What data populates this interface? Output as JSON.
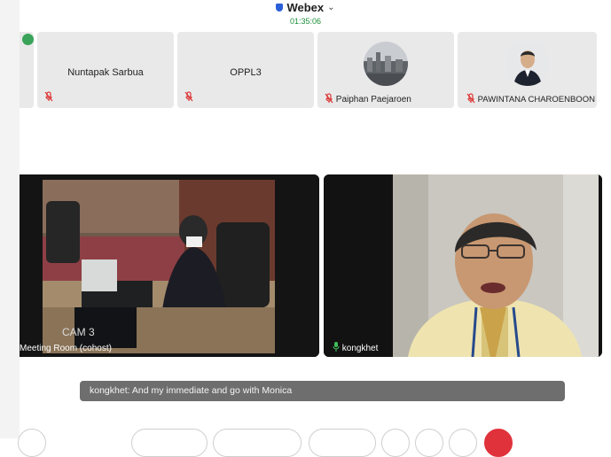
{
  "header": {
    "app_name": "Webex",
    "timer": "01:35:06"
  },
  "participants": [
    {
      "name": "Nuntapak Sarbua"
    },
    {
      "name": "OPPL3"
    },
    {
      "name": "Paiphan Paejaroen"
    },
    {
      "name": "PAWINTANA CHAROENBOON"
    }
  ],
  "videos": {
    "room": {
      "label": "Meeting Room (cohost)",
      "overlay": "CAM 3"
    },
    "speaker": {
      "label": "kongkhet"
    }
  },
  "caption": {
    "text": "kongkhet: And my immediate and go with Monica"
  },
  "colors": {
    "accent": "#2b5fd9",
    "timer": "#1d8f3a",
    "mute": "#d33333",
    "end_call": "#e0323b"
  },
  "icons": [
    "shield-icon",
    "chevron-down-icon",
    "mic-muted-icon",
    "mic-icon",
    "signal-icon",
    "record-icon"
  ]
}
